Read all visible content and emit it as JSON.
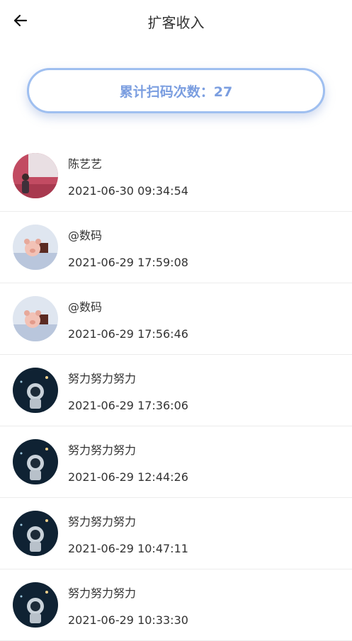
{
  "header": {
    "title": "扩客收入"
  },
  "counter": {
    "label": "累计扫码次数：27"
  },
  "records": [
    {
      "name": "陈艺艺",
      "time": "2021-06-30 09:34:54",
      "avatar": "woman-photo"
    },
    {
      "name": "@数码",
      "time": "2021-06-29 17:59:08",
      "avatar": "pig-toy-photo"
    },
    {
      "name": "@数码",
      "time": "2021-06-29 17:56:46",
      "avatar": "pig-toy-photo"
    },
    {
      "name": "努力努力努力",
      "time": "2021-06-29 17:36:06",
      "avatar": "astronaut-photo"
    },
    {
      "name": "努力努力努力",
      "time": "2021-06-29 12:44:26",
      "avatar": "astronaut-photo"
    },
    {
      "name": "努力努力努力",
      "time": "2021-06-29 10:47:11",
      "avatar": "astronaut-photo"
    },
    {
      "name": "努力努力努力",
      "time": "2021-06-29 10:33:30",
      "avatar": "astronaut-photo"
    }
  ],
  "colors": {
    "accent": "#7b9ee0",
    "border": "#9fbff0"
  }
}
